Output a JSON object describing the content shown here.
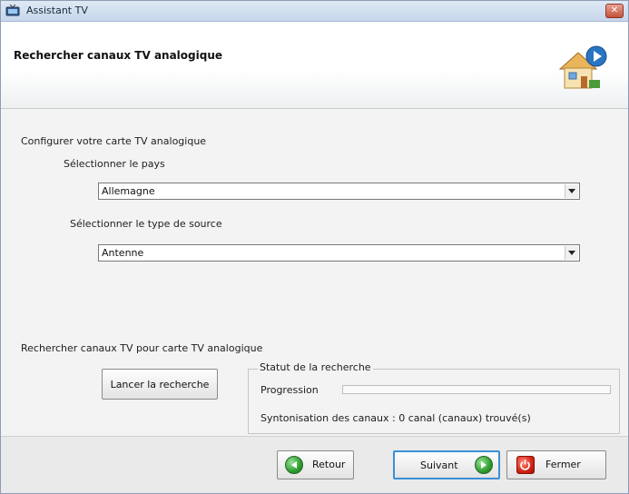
{
  "window": {
    "title": "Assistant TV"
  },
  "header": {
    "title": "Rechercher canaux TV analogique"
  },
  "config": {
    "section_label": "Configurer votre carte TV analogique",
    "country_label": "Sélectionner le pays",
    "country_value": "Allemagne",
    "source_label": "Sélectionner le type de source",
    "source_value": "Antenne"
  },
  "search": {
    "section_label": "Rechercher canaux TV pour carte TV analogique",
    "start_button": "Lancer la recherche",
    "status_title": "Statut de la recherche",
    "progress_label": "Progression",
    "progress_fraction": 0,
    "tuning_status": "Syntonisation des canaux : 0 canal (canaux) trouvé(s)"
  },
  "footer": {
    "back": "Retour",
    "next": "Suivant",
    "close": "Fermer"
  },
  "colors": {
    "title_bar": "#c6d6ea",
    "close_button": "#c4513a",
    "next_border": "#3b8fd6",
    "arrow_green": "#2d9c2d",
    "power_red": "#d42416"
  },
  "icons": {
    "app": "tv-icon",
    "header": "house-play-icon",
    "back": "back-arrow-icon",
    "next": "next-arrow-icon",
    "close": "power-icon"
  }
}
